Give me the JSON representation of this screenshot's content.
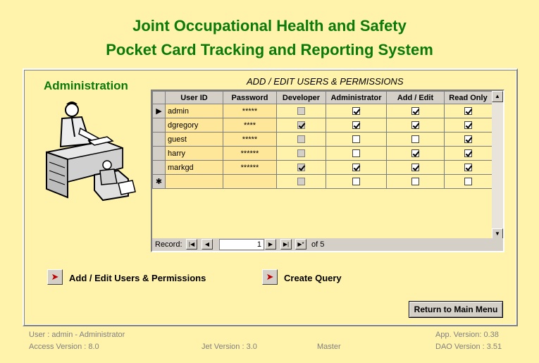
{
  "header": {
    "title_line1": "Joint Occupational Health and Safety",
    "title_line2": "Pocket Card Tracking and Reporting System"
  },
  "section_label": "Administration",
  "grid_title": "ADD / EDIT USERS & PERMISSIONS",
  "columns": [
    "User ID",
    "Password",
    "Developer",
    "Administrator",
    "Add / Edit",
    "Read Only"
  ],
  "rows": [
    {
      "user_id": "admin",
      "password": "*****",
      "developer": false,
      "administrator": true,
      "add_edit": true,
      "read_only": true,
      "current": true
    },
    {
      "user_id": "dgregory",
      "password": "****",
      "developer": true,
      "administrator": true,
      "add_edit": true,
      "read_only": true
    },
    {
      "user_id": "guest",
      "password": "*****",
      "developer": false,
      "administrator": false,
      "add_edit": false,
      "read_only": true
    },
    {
      "user_id": "harry",
      "password": "******",
      "developer": false,
      "administrator": false,
      "add_edit": true,
      "read_only": true
    },
    {
      "user_id": "markgd",
      "password": "******",
      "developer": true,
      "administrator": true,
      "add_edit": true,
      "read_only": true
    }
  ],
  "navigator": {
    "label": "Record:",
    "current": "1",
    "of_text": "of  5"
  },
  "actions": {
    "add_edit_users": "Add / Edit Users & Permissions",
    "create_query": "Create Query",
    "return_main": "Return to Main Menu"
  },
  "footer": {
    "user": "User : admin - Administrator",
    "access_version": "Access Version : 8.0",
    "jet_version": "Jet Version : 3.0",
    "master": "Master",
    "app_version": "App. Version: 0.38",
    "dao_version": "DAO Version : 3.51"
  },
  "icons": {
    "record_selector": "triangle-right",
    "new_record": "asterisk",
    "action_arrow": "red-arrow-right"
  }
}
